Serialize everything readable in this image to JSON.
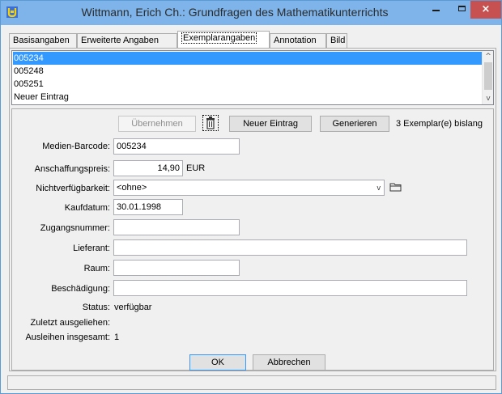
{
  "window": {
    "title": "Wittmann, Erich Ch.: Grundfragen des Mathematikunterrichts",
    "min_icon": "minimize-icon",
    "max_icon": "maximize-icon",
    "close_icon": "close-icon",
    "close_glyph": "×"
  },
  "tabs": [
    {
      "label": "Basisangaben"
    },
    {
      "label": "Erweiterte Angaben"
    },
    {
      "label": "Exemplarangaben"
    },
    {
      "label": "Annotation"
    },
    {
      "label": "Bild"
    }
  ],
  "copies_list": {
    "items": [
      "005234",
      "005248",
      "005251",
      "Neuer Eintrag"
    ],
    "selected": "005234",
    "scroll_up": "^",
    "scroll_down": "v"
  },
  "toolbar": {
    "apply_label": "Übernehmen",
    "delete_icon": "trash-icon",
    "new_entry_label": "Neuer Eintrag",
    "generate_label": "Generieren",
    "copy_count_text": "3 Exemplar(e) bislang"
  },
  "form": {
    "barcode_label": "Medien-Barcode:",
    "barcode_value": "005234",
    "price_label": "Anschaffungspreis:",
    "price_value": "14,90",
    "price_unit": "EUR",
    "unavailability_label": "Nichtverfügbarkeit:",
    "unavailability_value": "<ohne>",
    "unavailability_chevron": "v",
    "unavailability_button_icon": "folder-icon",
    "purchase_date_label": "Kaufdatum:",
    "purchase_date_value": "30.01.1998",
    "accession_label": "Zugangsnummer:",
    "accession_value": "",
    "supplier_label": "Lieferant:",
    "supplier_value": "",
    "room_label": "Raum:",
    "room_value": "",
    "damage_label": "Beschädigung:",
    "damage_value": "",
    "status_label": "Status:",
    "status_value": "verfügbar",
    "last_borrowed_label": "Zuletzt ausgeliehen:",
    "last_borrowed_value": "",
    "total_loans_label": "Ausleihen insgesamt:",
    "total_loans_value": "1"
  },
  "dialog_buttons": {
    "ok_label": "OK",
    "cancel_label": "Abbrechen"
  },
  "colors": {
    "titlebar": "#7eb4ea",
    "selection": "#3399ff",
    "close_button": "#c75050"
  }
}
